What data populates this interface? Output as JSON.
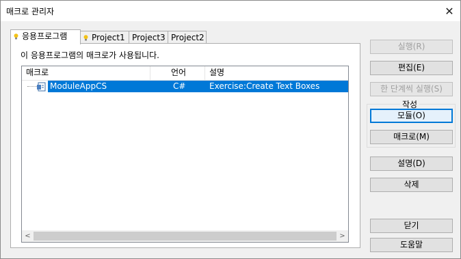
{
  "window": {
    "title": "매크로 관리자"
  },
  "tabs": [
    {
      "label": "응용프로그램",
      "active": true,
      "has_icon": true
    },
    {
      "label": "Project1",
      "active": false,
      "has_icon": true
    },
    {
      "label": "Project3",
      "active": false,
      "has_icon": false
    },
    {
      "label": "Project2",
      "active": false,
      "has_icon": false
    }
  ],
  "panel": {
    "description": "이 응용프로그램의 매크로가 사용됩니다."
  },
  "listview": {
    "columns": [
      "매크로",
      "언어",
      "설명"
    ],
    "rows": [
      {
        "macro": "ModuleAppCS",
        "language": "C#",
        "description": "Exercise:Create Text Boxes",
        "selected": true
      }
    ]
  },
  "buttons": {
    "run": "실행(R)",
    "edit": "편집(E)",
    "step_into": "한 단계씩 실행(S)",
    "create_group": "작성",
    "module": "모듈(O)",
    "macro": "매크로(M)",
    "describe": "설명(D)",
    "delete": "삭제",
    "close": "닫기",
    "help": "도움말"
  },
  "icons": {
    "close": "close-icon",
    "tab": "lightbulb-icon",
    "module": "module-icon",
    "scroll_left": "chevron-left-icon",
    "scroll_right": "chevron-right-icon"
  },
  "colors": {
    "selection": "#0078d7",
    "focus": "#0078d7",
    "bulb": "#f2c218"
  }
}
